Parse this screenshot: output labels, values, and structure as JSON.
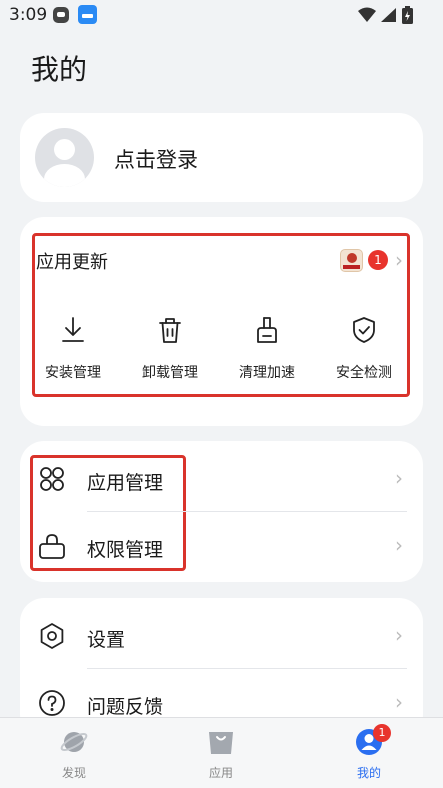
{
  "status_bar": {
    "time": "3:09"
  },
  "page": {
    "title": "我的"
  },
  "login": {
    "label": "点击登录"
  },
  "updates": {
    "title": "应用更新",
    "badge_count": "1",
    "tools": [
      {
        "label": "安装管理",
        "icon": "install-icon"
      },
      {
        "label": "卸载管理",
        "icon": "uninstall-icon"
      },
      {
        "label": "清理加速",
        "icon": "clean-icon"
      },
      {
        "label": "安全检测",
        "icon": "security-icon"
      }
    ]
  },
  "manage": {
    "items": [
      {
        "label": "应用管理",
        "icon": "app-grid-icon"
      },
      {
        "label": "权限管理",
        "icon": "lock-icon"
      }
    ]
  },
  "settings": {
    "items": [
      {
        "label": "设置",
        "icon": "gear-icon"
      },
      {
        "label": "问题反馈",
        "icon": "question-icon"
      }
    ]
  },
  "bottom_nav": {
    "items": [
      {
        "label": "发现",
        "icon": "planet-icon"
      },
      {
        "label": "应用",
        "icon": "bag-icon"
      },
      {
        "label": "我的",
        "icon": "profile-icon"
      }
    ],
    "active_index": 2,
    "profile_badge": "1"
  },
  "colors": {
    "accent": "#2a6ef0",
    "badge_red": "#e8342d",
    "highlight_box": "#d9332b",
    "background": "#f1f3f5"
  }
}
